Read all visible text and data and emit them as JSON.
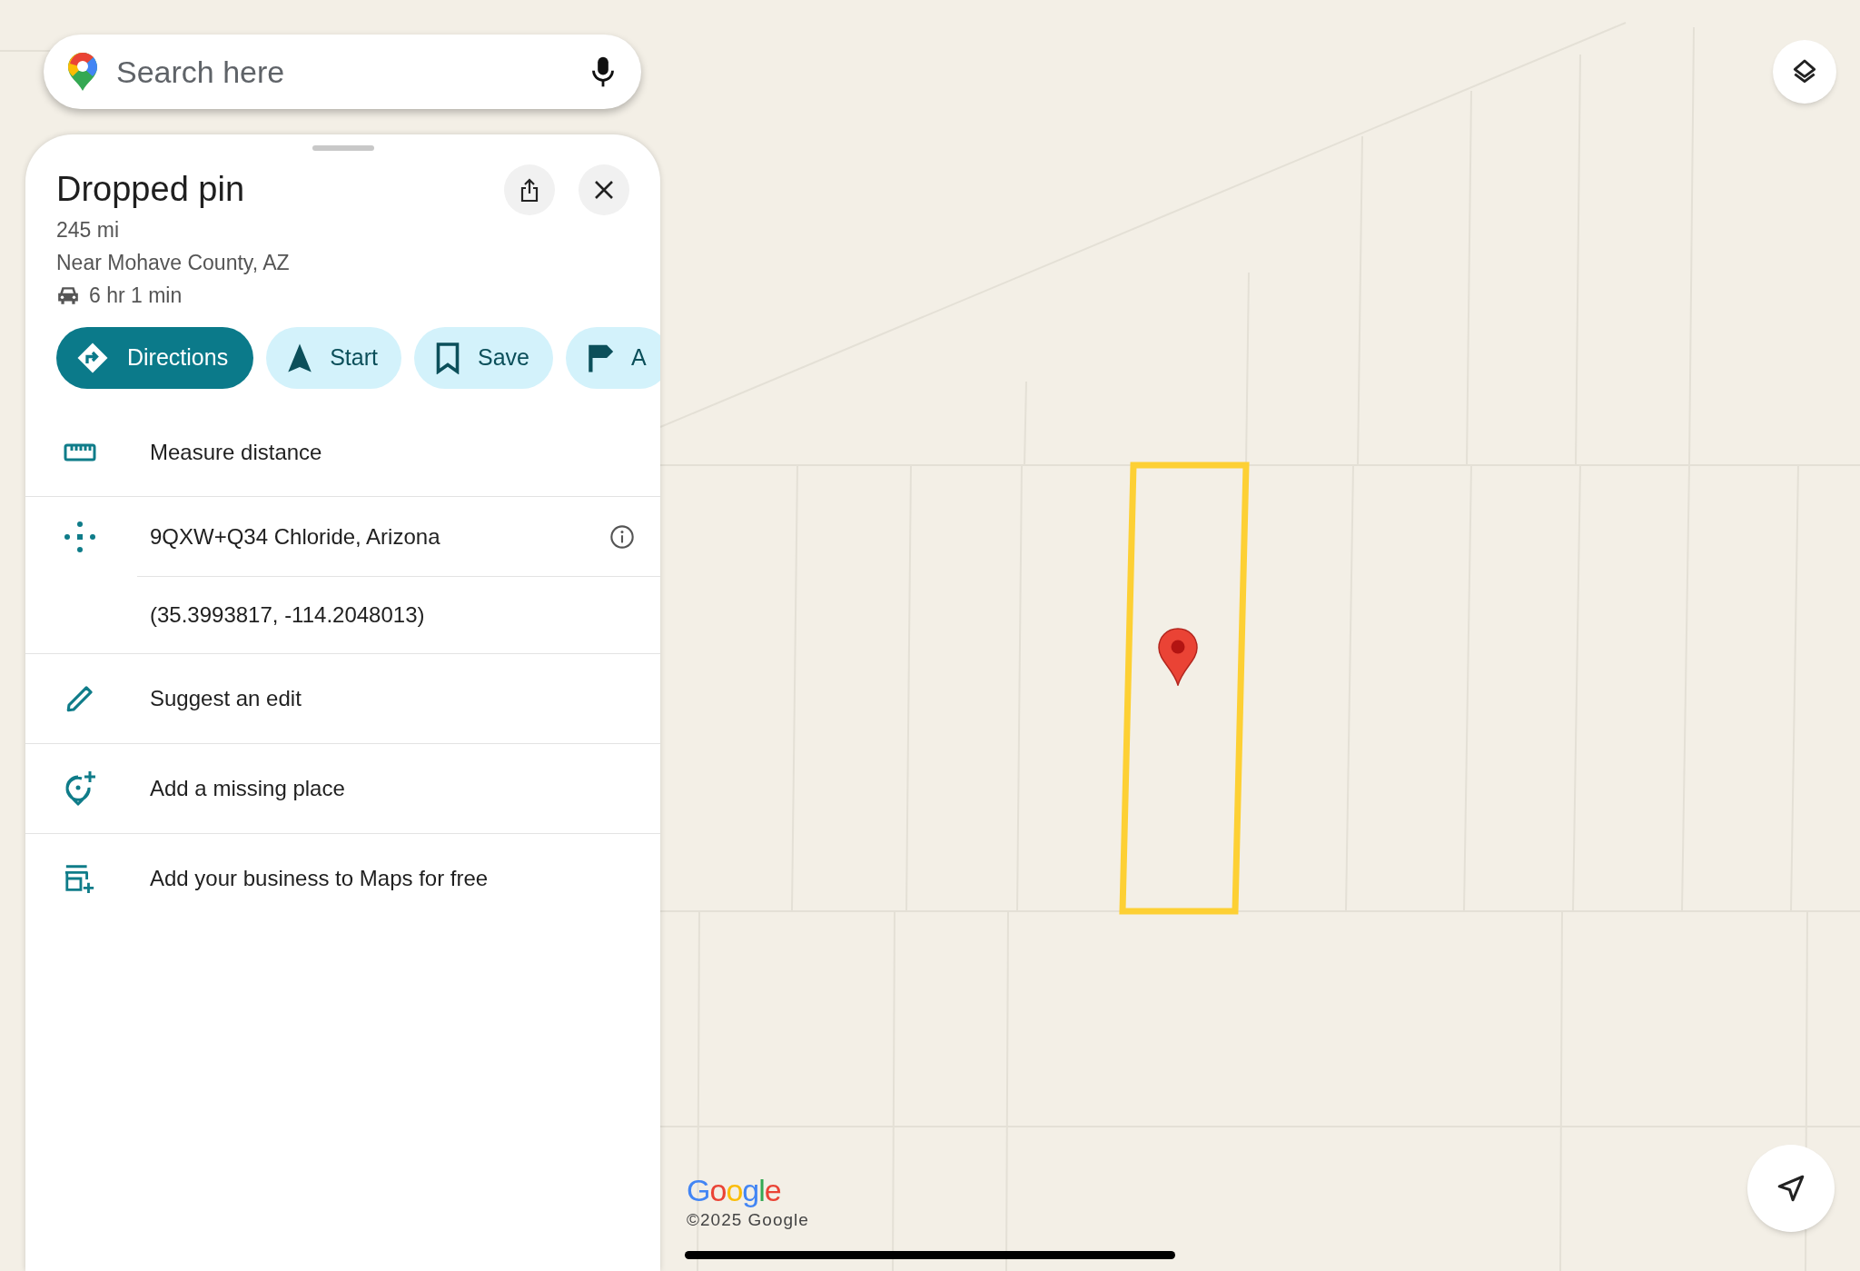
{
  "search": {
    "placeholder": "Search here"
  },
  "place": {
    "title": "Dropped pin",
    "distance": "245 mi",
    "locality": "Near Mohave County, AZ",
    "drive_time": "6 hr 1 min"
  },
  "actions": [
    {
      "kind": "directions",
      "label": "Directions",
      "filled": true
    },
    {
      "kind": "start",
      "label": "Start",
      "filled": false
    },
    {
      "kind": "save",
      "label": "Save",
      "filled": false
    },
    {
      "kind": "flag",
      "label": "A",
      "filled": false
    }
  ],
  "details": [
    {
      "kind": "measure",
      "text": "Measure distance"
    },
    {
      "kind": "plus_code",
      "text": "9QXW+Q34 Chloride, Arizona",
      "sub_text": "(35.3993817, -114.2048013)"
    },
    {
      "kind": "edit",
      "text": "Suggest an edit"
    },
    {
      "kind": "add_place",
      "text": "Add a missing place"
    },
    {
      "kind": "add_business",
      "text": "Add your business to Maps for free"
    }
  ],
  "map": {
    "logo": "Google",
    "copyright": "©2025 Google"
  }
}
